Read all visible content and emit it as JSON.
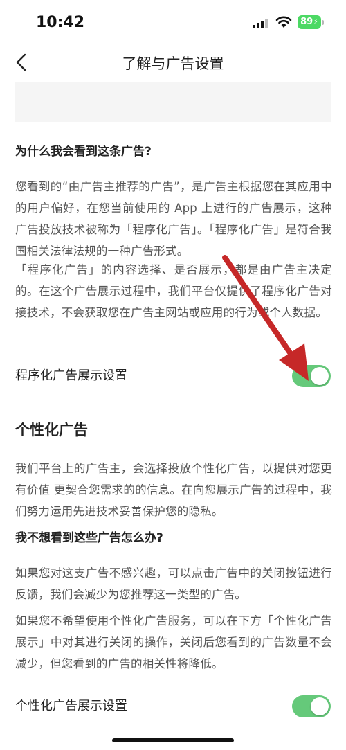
{
  "status_bar": {
    "time": "10:42",
    "battery": "89"
  },
  "nav": {
    "title": "了解与广告设置"
  },
  "section_why": {
    "heading": "为什么我会看到这条广告?",
    "para1": "您看到的“由广告主推荐的广告”，是广告主根据您在其应用中的用户偏好，在您当前使用的 App 上进行的广告展示，这种广告投放技术被称为「程序化广告」。「程序化广告」是符合我国相关法律法规的一种广告形式。",
    "para2": "「程序化广告」的内容选择、是否展示，都是由广告主决定的。在这个广告展示过程中，我们平台仅提供了程序化广告对接技术，不会获取您在广告主网站或应用的行为或个人数据。"
  },
  "setting_programmatic": {
    "label": "程序化广告展示设置",
    "enabled": true
  },
  "section_personal": {
    "heading": "个性化广告",
    "para1": "我们平台上的广告主，会选择投放个性化广告，以提供对您更有价值 更契合您需求的的信息。在向您展示广告的过程中，我们努力运用先进技术妥善保护您的隐私。",
    "subheading": "我不想看到这些广告怎么办?",
    "para2": "如果您对这支广告不感兴趣，可以点击广告中的关闭按钮进行反馈，我们会减少为您推荐这一类型的广告。",
    "para3": "如果您不希望使用个性化广告服务，可以在下方「个性化广告展示」中对其进行关闭的操作，关闭后您看到的广告数量不会减少，但您看到的广告的相关性将降低。"
  },
  "setting_personal": {
    "label": "个性化广告展示设置",
    "enabled": true
  },
  "colors": {
    "toggle_on": "#65c97a",
    "arrow": "#c62828",
    "battery": "#4cd964"
  }
}
